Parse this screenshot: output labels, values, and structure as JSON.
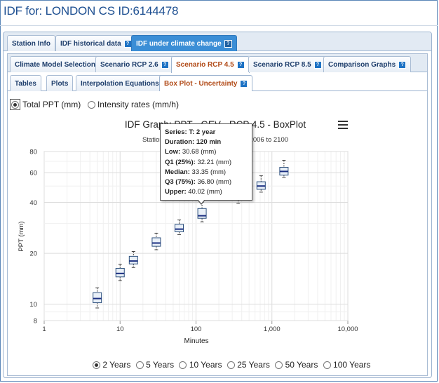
{
  "page": {
    "title": "IDF for: LONDON CS ID:6144478"
  },
  "tabs_level1": [
    {
      "label": "Station Info",
      "help": false
    },
    {
      "label": "IDF historical data",
      "help": true
    },
    {
      "label": "IDF under climate change",
      "help": true
    }
  ],
  "tabs_level2": [
    {
      "label": "Climate Model Selection"
    },
    {
      "label": "Scenario RCP 2.6"
    },
    {
      "label": "Scenario RCP 4.5"
    },
    {
      "label": "Scenario RCP 8.5"
    },
    {
      "label": "Comparison Graphs"
    }
  ],
  "tabs_level3": [
    {
      "label": "Tables"
    },
    {
      "label": "Plots"
    },
    {
      "label": "Interpolation Equations"
    },
    {
      "label": "Box Plot - Uncertainty"
    }
  ],
  "help_glyph": "?",
  "ppt_options": {
    "total": "Total PPT (mm)",
    "intensity": "Intensity rates (mm/h)"
  },
  "return_periods": [
    "2 Years",
    "5 Years",
    "10 Years",
    "25 Years",
    "50 Years",
    "100 Years"
  ],
  "tooltip": {
    "series_label": "Series:",
    "series_value": "T: 2 year",
    "duration_label": "Duration:",
    "duration_value": "120 min",
    "low_label": "Low:",
    "low_value": "30.68 (mm)",
    "q1_label": "Q1 (25%):",
    "q1_value": "32.21 (mm)",
    "median_label": "Median:",
    "median_value": "33.35 (mm)",
    "q3_label": "Q3 (75%):",
    "q3_value": "36.80 (mm)",
    "upper_label": "Upper:",
    "upper_value": "40.02 (mm)"
  },
  "colors": {
    "box_fill": "#e9f0f8",
    "box_stroke": "#2c4f7c",
    "median": "#1a2e80",
    "whisker": "#444444",
    "active_tab": "#3b8ed6",
    "title": "#1d4f91"
  },
  "chart_data": {
    "type": "boxplot",
    "title": "IDF Graph: PPT - GEV - RCP 4.5 - BoxPlot",
    "subtitle": "Station: , Model: All Models, Period: 2006 to 2100",
    "xlabel": "Minutes",
    "ylabel": "PPT (mm)",
    "x_scale": "log",
    "y_scale": "log",
    "xlim": [
      1,
      10000
    ],
    "ylim": [
      8,
      80
    ],
    "x_ticks": [
      1,
      10,
      100,
      1000,
      10000
    ],
    "x_tick_labels": [
      "1",
      "10",
      "100",
      "1,000",
      "10,000"
    ],
    "y_ticks": [
      8,
      10,
      20,
      40,
      60,
      80
    ],
    "y_tick_labels": [
      "8",
      "10",
      "20",
      "40",
      "60",
      "80"
    ],
    "series": [
      {
        "name": "T: 2 year",
        "boxes": [
          {
            "duration": 5,
            "low": 9.5,
            "q1": 10.2,
            "median": 10.8,
            "q3": 11.7,
            "upper": 12.5
          },
          {
            "duration": 10,
            "low": 13.8,
            "q1": 14.5,
            "median": 15.2,
            "q3": 16.3,
            "upper": 17.2
          },
          {
            "duration": 15,
            "low": 16.5,
            "q1": 17.3,
            "median": 18.0,
            "q3": 19.2,
            "upper": 20.5
          },
          {
            "duration": 30,
            "low": 21.0,
            "q1": 22.0,
            "median": 23.0,
            "q3": 24.7,
            "upper": 26.3
          },
          {
            "duration": 60,
            "low": 25.8,
            "q1": 26.8,
            "median": 27.8,
            "q3": 29.7,
            "upper": 31.5
          },
          {
            "duration": 120,
            "low": 30.68,
            "q1": 32.21,
            "median": 33.35,
            "q3": 36.8,
            "upper": 40.02
          },
          {
            "duration": 360,
            "low": 39.5,
            "q1": 41.3,
            "median": 43.2,
            "q3": 46.0,
            "upper": 48.0
          },
          {
            "duration": 720,
            "low": 46.0,
            "q1": 47.8,
            "median": 50.0,
            "q3": 53.0,
            "upper": 57.5
          },
          {
            "duration": 1440,
            "low": 56.0,
            "q1": 58.0,
            "median": 61.0,
            "q3": 64.5,
            "upper": 71.0
          }
        ]
      }
    ],
    "grid": {
      "x": true,
      "y": true
    }
  }
}
